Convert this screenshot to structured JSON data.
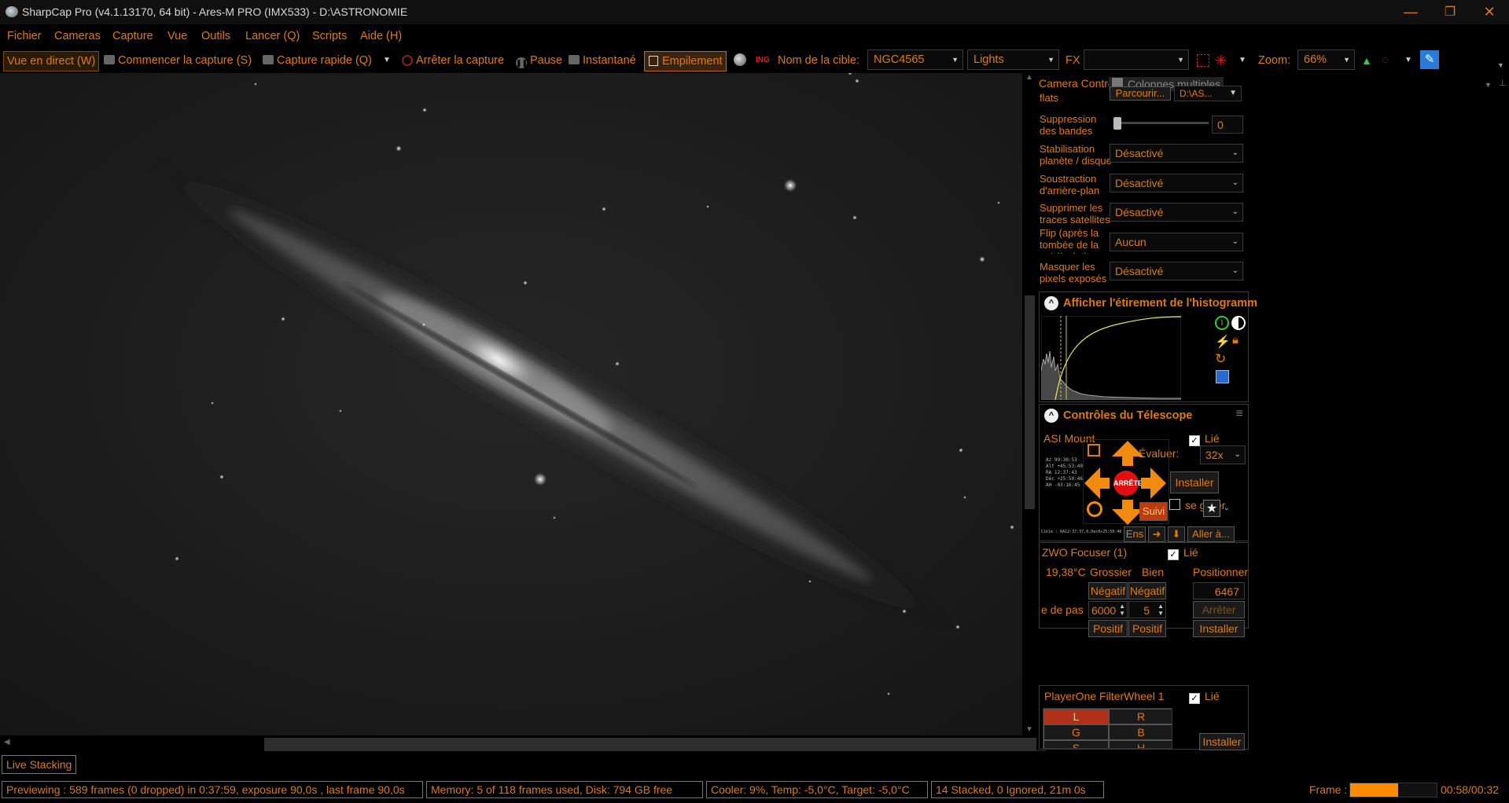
{
  "window": {
    "title": "SharpCap Pro (v4.1.13170, 64 bit) - Ares-M PRO (IMX533) - D:\\ASTRONOMIE",
    "minimize": "—",
    "restore": "❐",
    "close": "✕"
  },
  "menu": [
    "Fichier",
    "Cameras",
    "Capture",
    "Vue",
    "Outils",
    "Lancer (Q)",
    "Scripts",
    "Aide (H)"
  ],
  "toolbar": {
    "live_view": "Vue en direct (W)",
    "start_capture": "Commencer la capture (S)",
    "quick_capture": "Capture rapide (Q)",
    "stop_capture": "Arrêter la capture",
    "pause": "Pause",
    "snapshot": "Instantané",
    "stacking": "Empilement",
    "target_label": "Nom de la cible:",
    "target_value": "NGC4565",
    "frame_type": "Lights",
    "fx_label": "FX",
    "fx_value": "",
    "zoom_label": "Zoom:",
    "zoom_value": "66%"
  },
  "camera_controls": {
    "tab_label": "Camera Controls",
    "multi_columns": "Colonnes multiples",
    "flats_label": "flats",
    "browse_button": "Parcourir...",
    "path_value": "D:\\AS...",
    "banding_label": "Suppression des bandes",
    "banding_value": "0",
    "banding_level": 0.0,
    "stabilization_label": "Stabilisation planète / disque",
    "stabilization_value": "Désactivé",
    "background_label": "Soustraction d'arrière-plan",
    "background_value": "Désactivé",
    "satellite_label": "Supprimer les traces satellites",
    "satellite_value": "Désactivé",
    "flip_label": "Flip (après la tombée de la nuit/à plat)",
    "flip_value": "Aucun",
    "mask_label": "Masquer les pixels exposés",
    "mask_value": "Désactivé"
  },
  "histogram": {
    "title": "Afficher l'étirement de l'histogramm"
  },
  "telescope": {
    "title": "Contrôles du Télescope",
    "mount_name": "ASI Mount",
    "linked_label": "Lié",
    "evaluate_label": "Évaluer:",
    "rate_value": "32x",
    "install_button": "Installer",
    "stop_button": "ARRÊTE",
    "park_label": "se garer",
    "track_button": "Suivi",
    "set_button": "Ens",
    "goto_button": "Aller à...",
    "readout": [
      "Az 99:30:53",
      "Alt +45:53:40",
      "RA 12:37:43",
      "Déc +25:50:46",
      "AH -03:16:45"
    ],
    "target_line": "Cible : RA12:37:37,0,Dec0+25:50:46"
  },
  "focuser": {
    "name": "ZWO Focuser (1)",
    "linked_label": "Lié",
    "temperature": "19,38°C",
    "coarse_label": "Grossier",
    "fine_label": "Bien",
    "position_label": "Positionner",
    "negative": "Négatif",
    "position_value": "6467",
    "step_label": "e de pas",
    "coarse_step": "6000",
    "fine_step": "5",
    "stop_button": "Arrêter",
    "positive": "Positif",
    "install_button": "Installer"
  },
  "filterwheel": {
    "name": "PlayerOne FilterWheel 1",
    "linked_label": "Lié",
    "filters": [
      "L",
      "R",
      "G",
      "B",
      "S",
      "H"
    ],
    "selected": "L",
    "install_button": "Installer"
  },
  "live_stacking_tab": "Live Stacking",
  "status": {
    "preview": "Previewing : 589 frames (0 dropped) in 0:37:59, exposure 90,0s , last frame 90,0s",
    "memory": "Memory: 5 of 118 frames used, Disk: 794 GB free",
    "cooler": "Cooler: 9%, Temp: -5,0°C, Target: -5,0°C",
    "stacked": "14 Stacked, 0 Ignored, 21m 0s",
    "frame_label": "Frame :",
    "frame_progress": 0.55,
    "frame_time": "00:58/00:32"
  },
  "colors": {
    "accent": "#e07a10",
    "background": "#000000",
    "stop_red": "#e01010",
    "histogram_curve": "#e8e860"
  }
}
